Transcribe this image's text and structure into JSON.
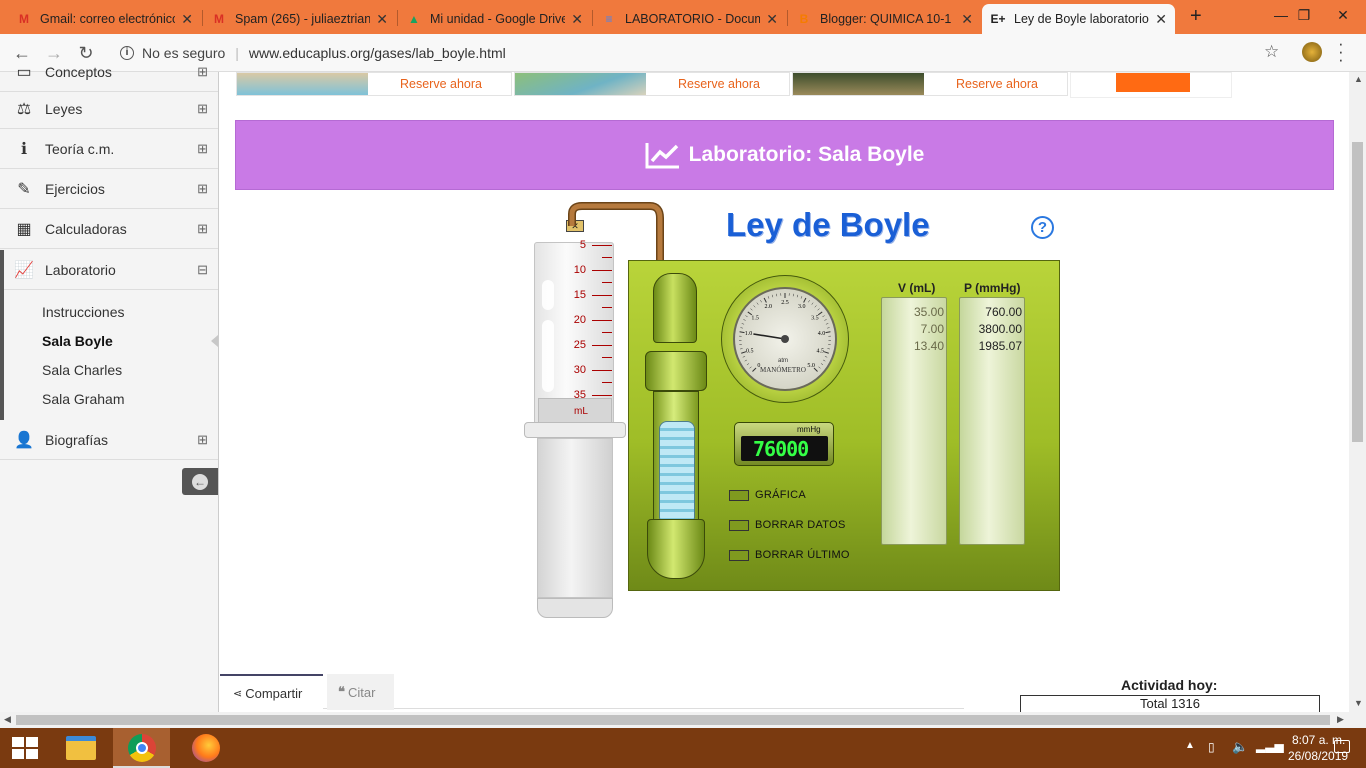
{
  "browser": {
    "tabs": [
      {
        "title": "Gmail: correo electrónico",
        "icon": "gmail-icon",
        "fav": "M",
        "favcolor": "#d93025"
      },
      {
        "title": "Spam (265) - juliaeztrian",
        "icon": "gmail-icon",
        "fav": "M",
        "favcolor": "#d93025"
      },
      {
        "title": "Mi unidad - Google Drive",
        "icon": "drive-icon",
        "fav": "▲",
        "favcolor": "#1aa260"
      },
      {
        "title": "LABORATORIO - Documento",
        "icon": "docs-icon",
        "fav": "≡",
        "favcolor": "#4285f4"
      },
      {
        "title": "Blogger: QUIMICA 10-1",
        "icon": "blogger-icon",
        "fav": "B",
        "favcolor": "#f57c00"
      },
      {
        "title": "Ley de Boyle laboratorio",
        "icon": "educaplus-icon",
        "fav": "E+",
        "favcolor": "#222"
      }
    ],
    "security_label": "No es seguro",
    "url": "www.educaplus.org/gases/lab_boyle.html"
  },
  "sidebar": {
    "items": [
      {
        "label": "Conceptos",
        "icon": "book-icon",
        "glyph": "▭",
        "toggle": "⊞"
      },
      {
        "label": "Leyes",
        "icon": "balance-icon",
        "glyph": "⚖",
        "toggle": "⊞"
      },
      {
        "label": "Teoría c.m.",
        "icon": "info-icon",
        "glyph": "ℹ",
        "toggle": "⊞"
      },
      {
        "label": "Ejercicios",
        "icon": "pencil-icon",
        "glyph": "✎",
        "toggle": "⊞"
      },
      {
        "label": "Calculadoras",
        "icon": "calculator-icon",
        "glyph": "▦",
        "toggle": "⊞"
      },
      {
        "label": "Laboratorio",
        "icon": "chart-line-icon",
        "glyph": "📈",
        "toggle": "⊟"
      },
      {
        "label": "Biografías",
        "icon": "user-icon",
        "glyph": "👤",
        "toggle": "⊞"
      }
    ],
    "subitems": [
      "Instrucciones",
      "Sala Boyle",
      "Sala Charles",
      "Sala Graham"
    ],
    "active_sub": "Sala Boyle"
  },
  "ads": [
    {
      "cta": "Reserve ahora"
    },
    {
      "cta": "Reserve ahora"
    },
    {
      "cta": "Reserve ahora"
    }
  ],
  "page": {
    "title": "Laboratorio: Sala Boyle"
  },
  "lab": {
    "heading": "Ley de Boyle",
    "help": "?",
    "syringe_scale": [
      "5",
      "10",
      "15",
      "20",
      "25",
      "30",
      "35"
    ],
    "syringe_unit": "mL",
    "gauge": {
      "ticks": [
        "0",
        "0.5",
        "1.0",
        "1.5",
        "2.0",
        "2.5",
        "3.0",
        "3.5",
        "4.0",
        "4.5",
        "5.0"
      ],
      "unit": "atm",
      "label": "MANÓMETRO"
    },
    "display": {
      "unit": "mmHg",
      "value": "76000"
    },
    "table": {
      "headers": [
        "V (mL)",
        "P (mmHg)"
      ],
      "volumes": [
        "35.00",
        "7.00",
        "13.40"
      ],
      "pressures": [
        "760.00",
        "3800.00",
        "1985.07"
      ]
    },
    "buttons": [
      "GRÁFICA",
      "BORRAR DATOS",
      "BORRAR ÚLTIMO"
    ]
  },
  "footer": {
    "share": "Compartir",
    "cite": "Citar",
    "activity_title": "Actividad hoy:",
    "activity_total_label": "Total",
    "activity_total_value": "1316"
  },
  "taskbar": {
    "time": "8:07 a. m.",
    "date": "26/08/2019"
  }
}
